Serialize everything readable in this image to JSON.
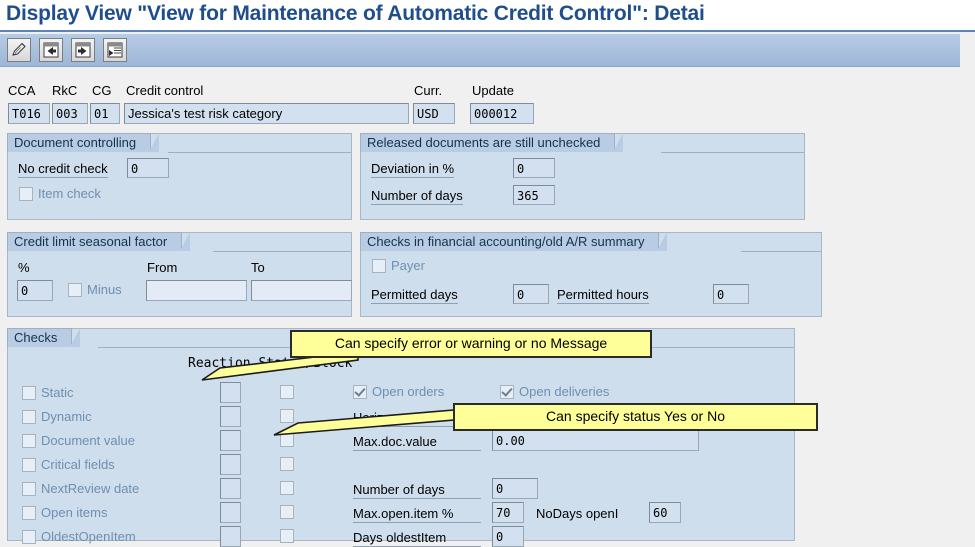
{
  "window": {
    "title": "Display View \"View for Maintenance of Automatic Credit Control\": Detai"
  },
  "toolbar": {
    "buttons": [
      {
        "name": "display-change-button",
        "icon": "pencil-icon",
        "label": "Display/Change"
      },
      {
        "name": "previous-entry-button",
        "icon": "arrow-left-box-icon",
        "label": "Previous Entry"
      },
      {
        "name": "next-entry-button",
        "icon": "arrow-right-box-icon",
        "label": "Next Entry"
      },
      {
        "name": "other-entry-button",
        "icon": "document-select-icon",
        "label": "Other Entry"
      }
    ]
  },
  "header": {
    "labels": {
      "cca": "CCA",
      "rkc": "RkC",
      "cg": "CG",
      "credit_control": "Credit control",
      "currency": "Curr.",
      "update": "Update"
    },
    "values": {
      "cca": "T016",
      "rkc": "003",
      "cg": "01",
      "credit_control": "Jessica's test risk category",
      "currency": "USD",
      "update": "000012"
    }
  },
  "document_controlling": {
    "title": "Document controlling",
    "no_credit_check_label": "No credit check",
    "no_credit_check_value": "0",
    "item_check_label": "Item check",
    "item_check_checked": false
  },
  "released_documents": {
    "title": "Released documents are still unchecked",
    "deviation_label": "Deviation in %",
    "deviation_value": "0",
    "number_of_days_label": "Number of days",
    "number_of_days_value": "365"
  },
  "seasonal_factor": {
    "title": "Credit limit seasonal factor",
    "percent_label": "%",
    "from_label": "From",
    "to_label": "To",
    "percent_value": "0",
    "minus_label": "Minus",
    "minus_checked": false,
    "from_value": "",
    "to_value": ""
  },
  "financial_checks": {
    "title": "Checks in financial accounting/old A/R summary",
    "payer_label": "Payer",
    "payer_checked": false,
    "permitted_days_label": "Permitted days",
    "permitted_days_value": "0",
    "permitted_hours_label": "Permitted hours",
    "permitted_hours_value": "0"
  },
  "checks": {
    "title": "Checks",
    "column_header": "Reaction Status/Block",
    "rows": [
      {
        "label": "Static",
        "checked": false,
        "reaction": "",
        "block": false
      },
      {
        "label": "Dynamic",
        "checked": false,
        "reaction": "",
        "block": false
      },
      {
        "label": "Document value",
        "checked": false,
        "reaction": "",
        "block": false
      },
      {
        "label": "Critical fields",
        "checked": false,
        "reaction": "",
        "block": false
      },
      {
        "label": "NextReview date",
        "checked": false,
        "reaction": "",
        "block": false
      },
      {
        "label": "Open items",
        "checked": false,
        "reaction": "",
        "block": false
      },
      {
        "label": "OldestOpenItem",
        "checked": false,
        "reaction": "",
        "block": false
      }
    ],
    "open_orders_label": "Open orders",
    "open_orders_checked": true,
    "open_deliveries_label": "Open deliveries",
    "open_deliveries_checked": true,
    "horizon_label": "Horizon",
    "horizon_value": "",
    "max_doc_value_label": "Max.doc.value",
    "max_doc_value": "0.00",
    "number_of_days_label": "Number of days",
    "number_of_days_value": "0",
    "max_open_item_label": "Max.open.item %",
    "max_open_item_value": "70",
    "nodays_openi_label": "NoDays openI",
    "nodays_openi_value": "60",
    "days_oldest_item_label": "Days oldestItem",
    "days_oldest_item_value": "0"
  },
  "callouts": [
    {
      "text": "Can specify error or warning or no Message"
    },
    {
      "text": "Can specify status Yes or No"
    }
  ],
  "colors": {
    "title_blue": "#1f4e8c",
    "toolbar_blue": "#a9c0dd",
    "panel_blue": "#cfdeed",
    "tab_blue": "#b8cde4",
    "field_blue": "#d3e0ef",
    "dim_text": "#6f8faf",
    "callout_yellow": "#ffff99",
    "page_bg": "#f0f0f0"
  }
}
